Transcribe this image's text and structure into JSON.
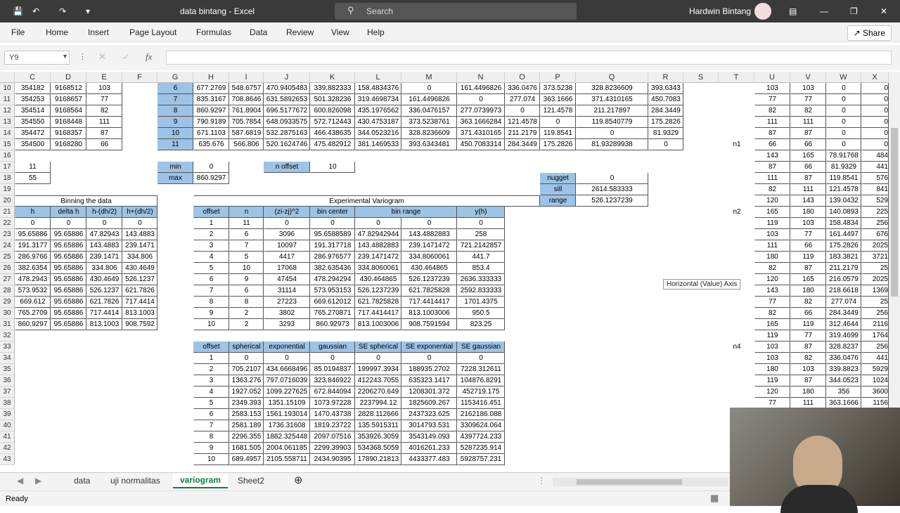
{
  "title_bar": {
    "doc_title": "data bintang  -  Excel",
    "search_placeholder": "Search",
    "user_name": "Hardwin Bintang"
  },
  "ribbon": {
    "tabs": [
      "File",
      "Home",
      "Insert",
      "Page Layout",
      "Formulas",
      "Data",
      "Review",
      "View",
      "Help"
    ],
    "share_label": "Share"
  },
  "formula_bar": {
    "name_box": "Y9",
    "formula": ""
  },
  "columns": [
    "C",
    "D",
    "E",
    "F",
    "G",
    "H",
    "I",
    "J",
    "K",
    "L",
    "M",
    "N",
    "O",
    "P",
    "Q",
    "R",
    "S",
    "T",
    "U",
    "V",
    "W",
    "X"
  ],
  "rows": [
    10,
    11,
    12,
    13,
    14,
    15,
    16,
    17,
    18,
    19,
    20,
    21,
    22,
    23,
    24,
    25,
    26,
    27,
    28,
    29,
    30,
    31,
    32,
    33,
    34,
    35,
    36,
    37,
    38,
    39,
    40,
    41,
    42,
    43
  ],
  "cde_rows": [
    [
      "354182",
      "9168512",
      "103"
    ],
    [
      "354253",
      "9168657",
      "77"
    ],
    [
      "354514",
      "9168564",
      "82"
    ],
    [
      "354550",
      "9168448",
      "111"
    ],
    [
      "354472",
      "9168357",
      "87"
    ],
    [
      "354500",
      "9168280",
      "66"
    ]
  ],
  "matrix": [
    [
      "6",
      "677.2769",
      "548.6757",
      "470.9405483",
      "339.882333",
      "158.4834376",
      "0",
      "161.4496826",
      "336.0476",
      "373.5238",
      "328.8236609",
      "393.6343"
    ],
    [
      "7",
      "835.3167",
      "708.8646",
      "631.5892653",
      "501.328236",
      "319.4698734",
      "161.4496826",
      "0",
      "277.074",
      "363.1666",
      "371.4310165",
      "450.7083"
    ],
    [
      "8",
      "860.9297",
      "761.8904",
      "696.5177672",
      "600.826098",
      "435.1976562",
      "336.0476157",
      "277.0739973",
      "0",
      "121.4578",
      "211.217897",
      "284.3449"
    ],
    [
      "9",
      "790.9189",
      "705.7854",
      "648.0933575",
      "572.712443",
      "430.4753187",
      "373.5238761",
      "363.1666284",
      "121.4578",
      "0",
      "119.8540779",
      "175.2826"
    ],
    [
      "10",
      "671.1103",
      "587.6819",
      "532.2875163",
      "466.438635",
      "344.0523216",
      "328.8236609",
      "371.4310165",
      "211.2179",
      "119.8541",
      "0",
      "81.9329"
    ],
    [
      "11",
      "635.676",
      "566.806",
      "520.1624746",
      "475.482912",
      "381.1469533",
      "393.6343481",
      "450.7083314",
      "284.3449",
      "175.2826",
      "81.93289938",
      "0"
    ]
  ],
  "c17": "11",
  "c18": "55",
  "minmax": {
    "min_label": "min",
    "min_value": "0",
    "max_label": "max",
    "max_value": "860.9297"
  },
  "n_offset": {
    "label": "n offset",
    "value": "10"
  },
  "params": {
    "nugget_label": "nugget",
    "nugget": "0",
    "sill_label": "sill",
    "sill": "2614.583333",
    "range_label": "range",
    "range": "526.1237239"
  },
  "binning": {
    "title": "Binning the data",
    "headers": [
      "h",
      "delta h",
      "h-(dh/2)",
      "h+(dh/2)"
    ],
    "rows": [
      [
        "0",
        "0",
        "0",
        "0"
      ],
      [
        "95.65886",
        "95.65886",
        "47.82943",
        "143.4883"
      ],
      [
        "191.3177",
        "95.65886",
        "143.4883",
        "239.1471"
      ],
      [
        "286.9766",
        "95.65886",
        "239.1471",
        "334.806"
      ],
      [
        "382.6354",
        "95.65886",
        "334.806",
        "430.4649"
      ],
      [
        "478.2943",
        "95.65886",
        "430.4649",
        "526.1237"
      ],
      [
        "573.9532",
        "95.65886",
        "526.1237",
        "621.7826"
      ],
      [
        "669.612",
        "95.65886",
        "621.7826",
        "717.4414"
      ],
      [
        "765.2709",
        "95.65886",
        "717.4414",
        "813.1003"
      ],
      [
        "860.9297",
        "95.65886",
        "813.1003",
        "908.7592"
      ]
    ]
  },
  "variogram": {
    "title": "Experimental Variogram",
    "headers": [
      "offset",
      "n",
      "(zi-zj)^2",
      "bin center",
      "bin range",
      "y(h)"
    ],
    "rows": [
      [
        "1",
        "11",
        "0",
        "0",
        "0",
        "0",
        "0"
      ],
      [
        "2",
        "6",
        "3096",
        "95.6588589",
        "47.82942944",
        "143.4882883",
        "258"
      ],
      [
        "3",
        "7",
        "10097",
        "191.317718",
        "143.4882883",
        "239.1471472",
        "721.2142857"
      ],
      [
        "4",
        "5",
        "4417",
        "286.976577",
        "239.1471472",
        "334.8060061",
        "441.7"
      ],
      [
        "5",
        "10",
        "17068",
        "382.635436",
        "334.8060061",
        "430.464865",
        "853.4"
      ],
      [
        "6",
        "9",
        "47454",
        "478.294294",
        "430.464865",
        "526.1237239",
        "2636.333333"
      ],
      [
        "7",
        "6",
        "31114",
        "573.953153",
        "526.1237239",
        "621.7825828",
        "2592.833333"
      ],
      [
        "8",
        "8",
        "27223",
        "669.612012",
        "621.7825828",
        "717.4414417",
        "1701.4375"
      ],
      [
        "9",
        "2",
        "3802",
        "765.270871",
        "717.4414417",
        "813.1003006",
        "950.5"
      ],
      [
        "10",
        "2",
        "3293",
        "860.92973",
        "813.1003006",
        "908.7591594",
        "823.25"
      ]
    ]
  },
  "models": {
    "headers": [
      "offset",
      "spherical",
      "exponential",
      "gaussian",
      "SE spherical",
      "SE exponential",
      "SE gaussian"
    ],
    "rows": [
      [
        "1",
        "0",
        "0",
        "0",
        "0",
        "0",
        "0"
      ],
      [
        "2",
        "705.2107",
        "434.6668496",
        "85.0194837",
        "199997.3934",
        "188935.2702",
        "7228.312611"
      ],
      [
        "3",
        "1363.276",
        "797.0716039",
        "323.846922",
        "412243.7055",
        "635323.1417",
        "104876.8291"
      ],
      [
        "4",
        "1927.052",
        "1099.227625",
        "672.844094",
        "2206270.649",
        "1208301.372",
        "452719.175"
      ],
      [
        "5",
        "2349.393",
        "1351.15109",
        "1073.97228",
        "2237994.12",
        "1825609.267",
        "1153416.451"
      ],
      [
        "6",
        "2583.153",
        "1561.193014",
        "1470.43738",
        "2828.112666",
        "2437323.625",
        "2162186.088"
      ],
      [
        "7",
        "2581.189",
        "1736.31608",
        "1819.23722",
        "135.5915311",
        "3014793.531",
        "3309624.064"
      ],
      [
        "8",
        "2296.355",
        "1882.325448",
        "2097.07516",
        "353926.3059",
        "3543149.093",
        "4397724.233"
      ],
      [
        "9",
        "1681.505",
        "2004.061185",
        "2299.39903",
        "534368.5059",
        "4016261.233",
        "5287235.914"
      ],
      [
        "10",
        "689.4957",
        "2105.558711",
        "2434.90395",
        "17890.21813",
        "4433377.483",
        "5928757.231"
      ]
    ]
  },
  "t_labels": {
    "n1": "n1",
    "n2": "n2",
    "n4": "n4"
  },
  "uvwx_rows": [
    [
      "103",
      "103",
      "0",
      "0"
    ],
    [
      "77",
      "77",
      "0",
      "0"
    ],
    [
      "82",
      "82",
      "0",
      "0"
    ],
    [
      "111",
      "111",
      "0",
      "0"
    ],
    [
      "87",
      "87",
      "0",
      "0"
    ],
    [
      "66",
      "66",
      "0",
      "0"
    ],
    [
      "143",
      "165",
      "78.91768",
      "484"
    ],
    [
      "87",
      "66",
      "81.9329",
      "441"
    ],
    [
      "111",
      "87",
      "119.8541",
      "576"
    ],
    [
      "82",
      "111",
      "121.4578",
      "841"
    ],
    [
      "120",
      "143",
      "139.0432",
      "529"
    ],
    [
      "165",
      "180",
      "140.0893",
      "225"
    ],
    [
      "119",
      "103",
      "158.4834",
      "256"
    ],
    [
      "103",
      "77",
      "161.4497",
      "676"
    ],
    [
      "111",
      "66",
      "175.2826",
      "2025"
    ],
    [
      "180",
      "119",
      "183.3821",
      "3721"
    ],
    [
      "82",
      "87",
      "211.2179",
      "25"
    ],
    [
      "120",
      "165",
      "216.0579",
      "2025"
    ],
    [
      "143",
      "180",
      "218.6618",
      "1369"
    ],
    [
      "77",
      "82",
      "277.074",
      "25"
    ],
    [
      "82",
      "66",
      "284.3449",
      "256"
    ],
    [
      "165",
      "119",
      "312.4644",
      "2116"
    ],
    [
      "119",
      "77",
      "319.4699",
      "1764"
    ],
    [
      "103",
      "87",
      "328.8237",
      "256"
    ],
    [
      "103",
      "82",
      "336.0476",
      "441"
    ],
    [
      "180",
      "103",
      "339.8823",
      "5929"
    ],
    [
      "119",
      "87",
      "344.0523",
      "1024"
    ],
    [
      "120",
      "180",
      "356",
      "3600"
    ],
    [
      "77",
      "111",
      "363.1666",
      "1156"
    ]
  ],
  "tooltip": "Horizontal (Value) Axis",
  "sheet_tabs": [
    "data",
    "uji normalitas",
    "variogram",
    "Sheet2"
  ],
  "active_sheet": "variogram",
  "status": "Ready"
}
